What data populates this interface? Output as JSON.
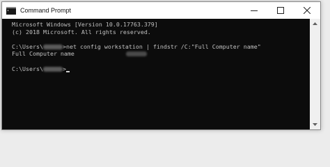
{
  "window": {
    "title": "Command Prompt",
    "icon": "console-icon"
  },
  "console": {
    "lines": [
      {
        "text": "Microsoft Windows [Version 10.0.17763.379]"
      },
      {
        "text": "(c) 2018 Microsoft. All rights reserved."
      },
      {
        "text": ""
      },
      {
        "prefix": "C:\\Users\\",
        "redacted": true,
        "suffix": ">net config workstation | findstr /C:\"Full Computer name\""
      },
      {
        "text": "Full Computer name",
        "redacted_tail": true
      },
      {
        "text": ""
      },
      {
        "prefix": "C:\\Users\\",
        "redacted": true,
        "suffix": ">",
        "cursor": true
      }
    ]
  },
  "colors": {
    "console_bg": "#0c0c0c",
    "console_fg": "#c0c0c0",
    "titlebar_bg": "#ffffff"
  }
}
